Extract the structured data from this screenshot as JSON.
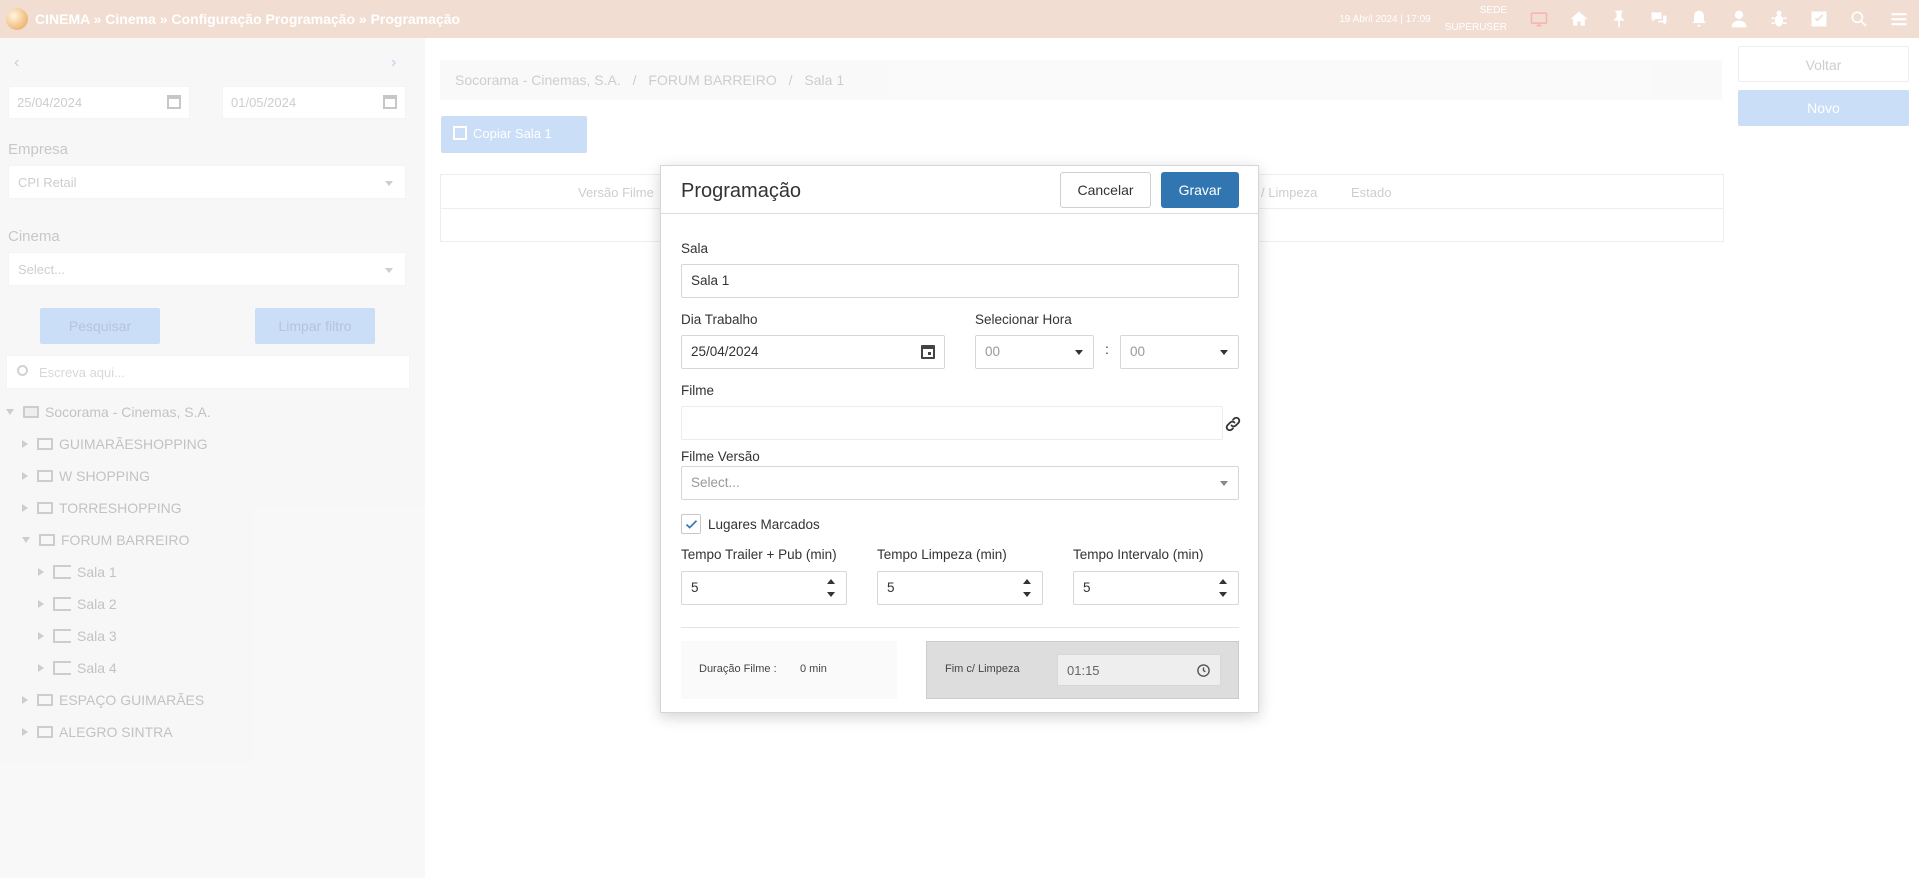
{
  "topbar": {
    "breadcrumb": "CINEMA » Cinema » Configuração Programação » Programação",
    "datetime": "19 Abril 2024 | 17:09",
    "location": "SEDE",
    "user": "SUPERUSER",
    "icons": [
      "monitor-alert-icon",
      "home-icon",
      "pin-icon",
      "chat-icon",
      "bell-icon",
      "user-icon",
      "bug-icon",
      "checkbox-icon",
      "search-icon",
      "menu-icon"
    ]
  },
  "left_panel": {
    "date_from": "25/04/2024",
    "date_to": "01/05/2024",
    "empresa_label": "Empresa",
    "empresa_value": "CPI Retail",
    "cinema_label": "Cinema",
    "cinema_placeholder": "Select...",
    "search_button": "Pesquisar",
    "clear_button": "Limpar filtro",
    "search_placeholder": "Escreva aqui...",
    "tree": {
      "root": "Socorama - Cinemas, S.A.",
      "cinemas": [
        "GUIMARÃESHOPPING",
        "W SHOPPING",
        "TORRESHOPPING",
        "FORUM BARREIRO",
        "ESPAÇO GUIMARÃES",
        "ALEGRO SINTRA"
      ],
      "salas": [
        "Sala 1",
        "Sala 2",
        "Sala 3",
        "Sala 4"
      ]
    }
  },
  "main": {
    "breadcrumb": [
      "Socorama - Cinemas, S.A.",
      "FORUM BARREIRO",
      "Sala 1"
    ],
    "copy_button": "Copiar Sala 1",
    "columns": [
      "Versão Filme",
      "/ Limpeza",
      "Estado"
    ],
    "back_button": "Voltar",
    "new_button": "Novo"
  },
  "modal": {
    "title": "Programação",
    "cancel": "Cancelar",
    "save": "Gravar",
    "sala_label": "Sala",
    "sala_value": "Sala 1",
    "dia_label": "Dia Trabalho",
    "dia_value": "25/04/2024",
    "hora_label": "Selecionar Hora",
    "hora_value": "00",
    "minuto_value": "00",
    "colon": ":",
    "filme_label": "Filme",
    "filme_value": "",
    "versao_label": "Filme Versão",
    "versao_placeholder": "Select...",
    "lugares_label": "Lugares Marcados",
    "lugares_checked": true,
    "trailer_label": "Tempo Trailer + Pub (min)",
    "trailer_value": "5",
    "limpeza_label": "Tempo Limpeza (min)",
    "limpeza_value": "5",
    "intervalo_label": "Tempo Intervalo (min)",
    "intervalo_value": "5",
    "duracao_label": "Duração Filme :",
    "duracao_value": "0 min",
    "fim_label": "Fim c/ Limpeza",
    "fim_value": "01:15"
  },
  "colors": {
    "topbar": "#f1ddd1",
    "primary": "#3276b1",
    "check": "#3276b1"
  }
}
